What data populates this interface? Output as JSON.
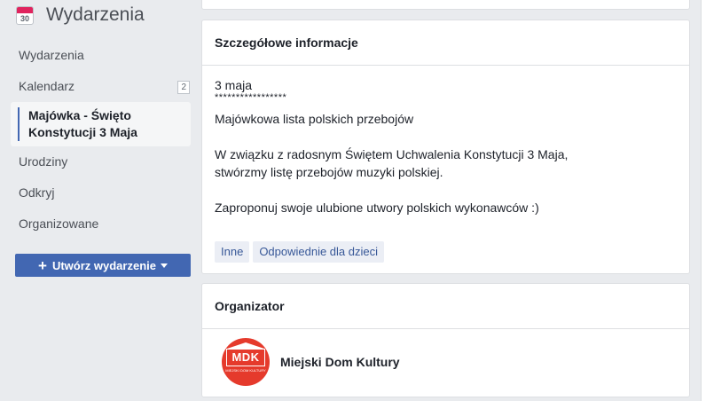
{
  "app": {
    "title": "Wydarzenia",
    "calendar_day": "30"
  },
  "sidebar": {
    "items": [
      {
        "label": "Wydarzenia"
      },
      {
        "label": "Kalendarz",
        "badge": "2"
      },
      {
        "label_line1": "Majówka - Święto",
        "label_line2": "Konstytucji 3 Maja"
      },
      {
        "label": "Urodziny"
      },
      {
        "label": "Odkryj"
      },
      {
        "label": "Organizowane"
      }
    ],
    "create_button": "Utwórz wydarzenie"
  },
  "details": {
    "header": "Szczegółowe informacje",
    "line1": "3 maja",
    "stars": "*****************",
    "line2": "Majówkowa lista  polskich przebojów",
    "line3": "W związku z radosnym Świętem Uchwalenia Konstytucji 3 Maja,",
    "line4": "stwórzmy listę przebojów muzyki polskiej.",
    "line5": "Zaproponuj swoje ulubione utwory polskich wykonawców :)",
    "tags": [
      "Inne",
      "Odpowiednie dla dzieci"
    ]
  },
  "organizer": {
    "header": "Organizator",
    "logo_text": "MDK",
    "logo_small": "MIEJSKI DOM KULTURY",
    "name": "Miejski Dom Kultury"
  },
  "colors": {
    "accent": "#4267b2",
    "background": "#e9ebee",
    "logo_red": "#e53a2c"
  }
}
